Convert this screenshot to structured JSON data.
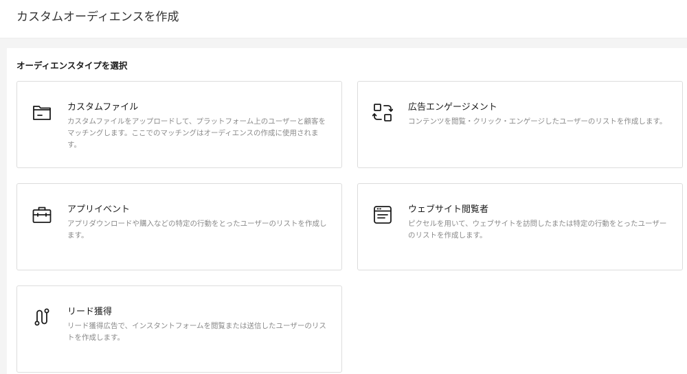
{
  "header": {
    "title": "カスタムオーディエンスを作成"
  },
  "main": {
    "section_title": "オーディエンスタイプを選択",
    "cards": [
      {
        "icon": "folder-icon",
        "title": "カスタムファイル",
        "description": "カスタムファイルをアップロードして、プラットフォーム上のユーザーと顧客をマッチングします。ここでのマッチングはオーディエンスの作成に使用されます。"
      },
      {
        "icon": "engagement-icon",
        "title": "広告エンゲージメント",
        "description": "コンテンツを閲覧・クリック・エンゲージしたユーザーのリストを作成します。"
      },
      {
        "icon": "briefcase-icon",
        "title": "アプリイベント",
        "description": "アプリダウンロードや購入などの特定の行動をとったユーザーのリストを作成します。"
      },
      {
        "icon": "browser-window-icon",
        "title": "ウェブサイト閲覧者",
        "description": "ピクセルを用いて、ウェブサイトを訪問したまたは特定の行動をとったユーザーのリストを作成します。"
      },
      {
        "icon": "lead-path-icon",
        "title": "リード獲得",
        "description": "リード獲得広告で、インスタントフォームを閲覧または送信したユーザーのリストを作成します。"
      }
    ]
  },
  "colors": {
    "card_border": "#dcdcdc",
    "description_text": "#8a8a8a",
    "page_background": "#f4f4f4"
  }
}
